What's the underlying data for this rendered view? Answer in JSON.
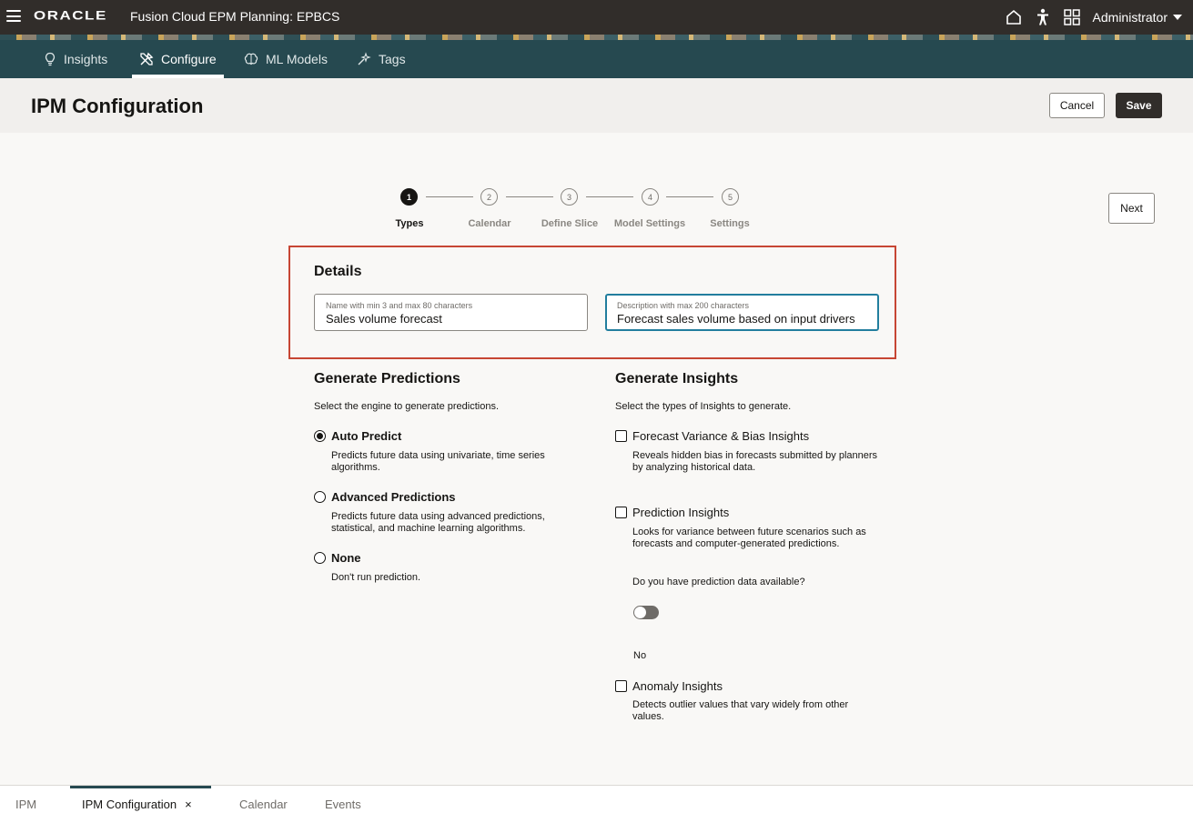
{
  "topbar": {
    "logo": "ORACLE",
    "app_title": "Fusion Cloud EPM Planning:  EPBCS",
    "user": "Administrator",
    "icons": [
      "menu-icon",
      "home-icon",
      "accessibility-icon",
      "apps-grid-icon",
      "chevron-down-icon"
    ]
  },
  "nav": {
    "tabs": [
      {
        "label": "Insights",
        "icon": "lightbulb-icon"
      },
      {
        "label": "Configure",
        "icon": "tools-icon",
        "active": true
      },
      {
        "label": "ML Models",
        "icon": "brain-icon"
      },
      {
        "label": "Tags",
        "icon": "sparkle-icon"
      }
    ]
  },
  "header": {
    "title": "IPM Configuration",
    "cancel_label": "Cancel",
    "save_label": "Save"
  },
  "stepper": {
    "steps": [
      {
        "number": "1",
        "label": "Types",
        "active": true
      },
      {
        "number": "2",
        "label": "Calendar"
      },
      {
        "number": "3",
        "label": "Define Slice"
      },
      {
        "number": "4",
        "label": "Model Settings"
      },
      {
        "number": "5",
        "label": "Settings"
      }
    ],
    "next_label": "Next"
  },
  "details": {
    "heading": "Details",
    "name_label": "Name with min 3 and max 80 characters",
    "name_value": "Sales volume forecast",
    "description_label": "Description with max 200 characters",
    "description_value": "Forecast sales volume based on input drivers"
  },
  "predictions": {
    "heading": "Generate Predictions",
    "intro": "Select the engine to generate predictions.",
    "options": [
      {
        "label": "Auto Predict",
        "desc1": "Predicts future data using univariate, time series",
        "desc2": "algorithms.",
        "checked": true
      },
      {
        "label": "Advanced Predictions",
        "desc1": "Predicts future data using advanced predictions,",
        "desc2": "statistical, and machine learning algorithms."
      },
      {
        "label": "None",
        "desc1": "Don't run prediction."
      }
    ]
  },
  "insights": {
    "heading": "Generate Insights",
    "intro": "Select the types of Insights to generate.",
    "options": [
      {
        "label": "Forecast Variance & Bias Insights",
        "desc1": "Reveals hidden bias in forecasts submitted by planners",
        "desc2": "by analyzing historical data."
      },
      {
        "label": "Prediction Insights",
        "desc1": "Looks for variance between future scenarios such as",
        "desc2": "forecasts and computer-generated predictions."
      },
      {
        "label": "Anomaly Insights",
        "desc1": "Detects outlier values that vary widely from other",
        "desc2": "values."
      }
    ],
    "prediction_question": "Do you have prediction data available?",
    "prediction_toggle_value": "No"
  },
  "bottom_tabs": {
    "tabs": [
      {
        "label": "IPM"
      },
      {
        "label": "IPM Configuration",
        "active": true,
        "close": "×"
      },
      {
        "label": "Calendar"
      },
      {
        "label": "Events"
      }
    ]
  },
  "colors": {
    "topbar": "#312d2a",
    "navbar": "#264950",
    "highlight_border": "#c74634",
    "focus_border": "#227e9e"
  }
}
